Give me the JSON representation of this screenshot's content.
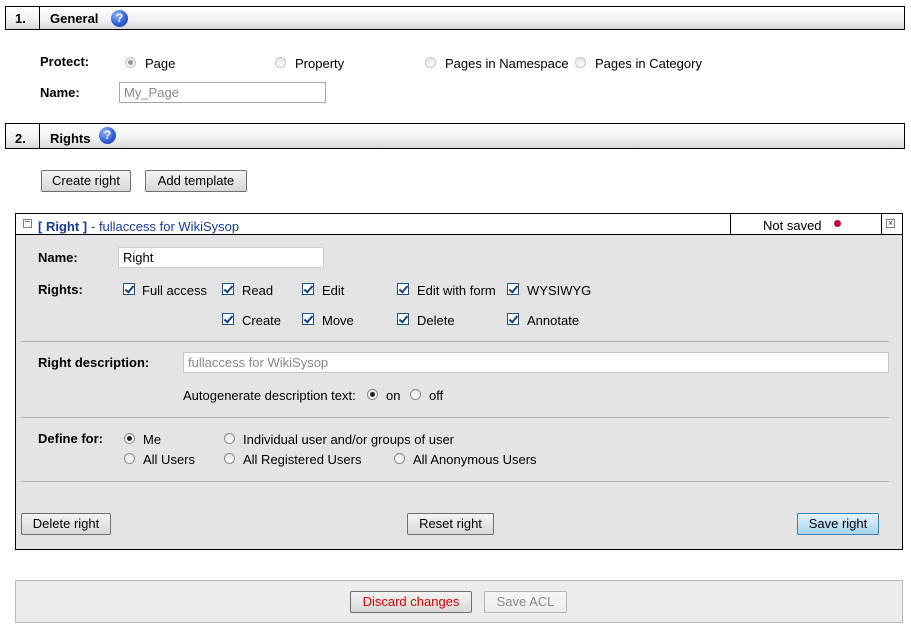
{
  "general": {
    "number": "1.",
    "title": "General",
    "protect_label": "Protect:",
    "protect_options": [
      "Page",
      "Property",
      "Pages in Namespace",
      "Pages in Category"
    ],
    "name_label": "Name:",
    "name_value": "My_Page"
  },
  "rights_section": {
    "number": "2.",
    "title": "Rights",
    "create_right": "Create right",
    "add_template": "Add template"
  },
  "right_panel": {
    "header_bold": "[ Right ]",
    "header_desc": " - fullaccess for WikiSysop",
    "status": "Not saved",
    "status_color": "#cc0033",
    "close_icon": "close-icon",
    "name_label": "Name:",
    "name_value": "Right",
    "rights_label": "Rights:",
    "rights": [
      "Full access",
      "Read",
      "Edit",
      "Edit with form",
      "WYSIWYG",
      "Create",
      "Move",
      "Delete",
      "Annotate"
    ],
    "desc_label": "Right description:",
    "desc_value": "fullaccess for WikiSysop",
    "autogen_label": "Autogenerate description text:",
    "autogen_on": "on",
    "autogen_off": "off",
    "define_label": "Define for:",
    "define_options": [
      "Me",
      "Individual user and/or groups of user",
      "All Users",
      "All Registered Users",
      "All Anonymous Users"
    ],
    "delete_btn": "Delete right",
    "reset_btn": "Reset right",
    "save_btn": "Save right"
  },
  "footer": {
    "discard": "Discard changes",
    "save_acl": "Save ACL"
  }
}
